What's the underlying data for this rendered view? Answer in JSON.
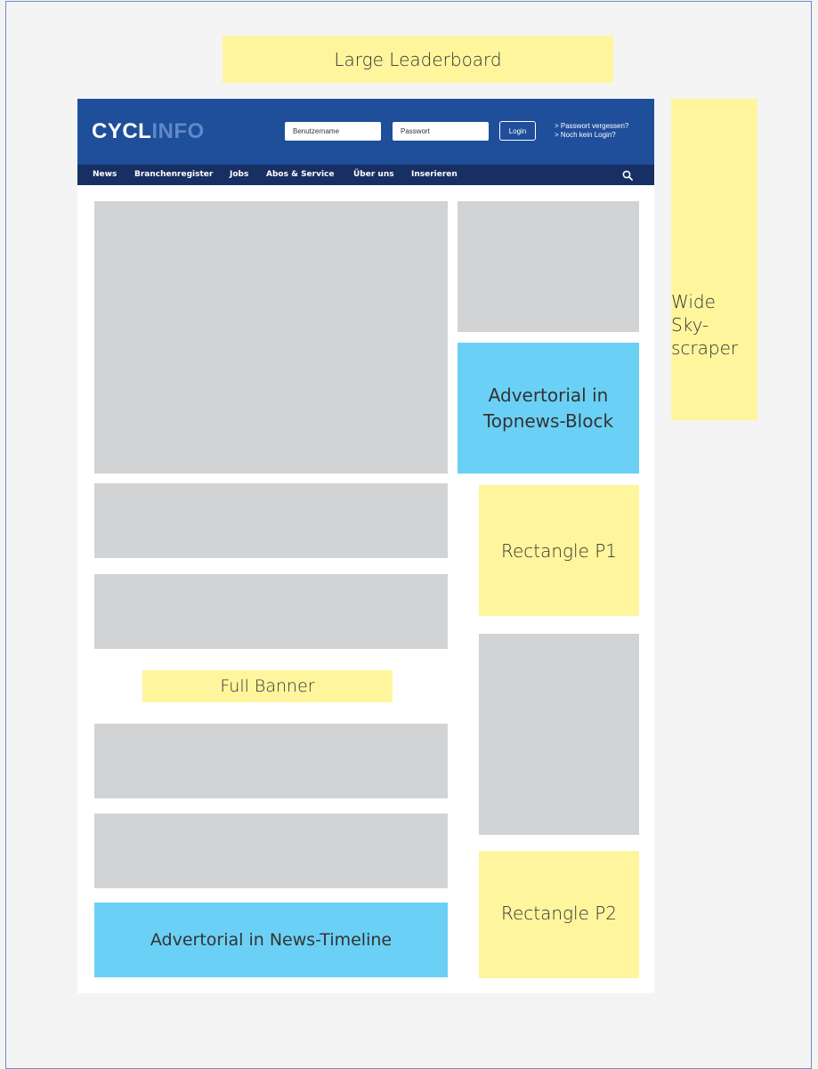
{
  "ads": {
    "large_leaderboard": "Large Leaderboard",
    "wide_skyscraper": [
      "Wide",
      "Sky-",
      "scraper"
    ],
    "advertorial_topnews": [
      "Advertorial in",
      "Topnews-Block"
    ],
    "rectangle_p1": "Rectangle P1",
    "full_banner": "Full Banner",
    "rectangle_p2": "Rectangle P2",
    "advertorial_timeline": "Advertorial in News-Timeline"
  },
  "header": {
    "logo_part1": "CYCL",
    "logo_part2": "INFO",
    "username_placeholder": "Benutzername",
    "password_placeholder": "Passwort",
    "login_label": "Login",
    "forgot_link": "> Passwort vergessen?",
    "no_login_link": "> Noch kein Login?"
  },
  "nav": {
    "items": [
      "News",
      "Branchenregister",
      "Jobs",
      "Abos & Service",
      "Über uns",
      "Inserieren"
    ],
    "search_icon": "search-icon"
  },
  "colors": {
    "ad_yellow": "#fff59d",
    "advertorial_blue": "#6bd0f5",
    "header_blue": "#1f4e9a",
    "nav_navy": "#172f62",
    "placeholder_gray": "#d2d3d5"
  }
}
